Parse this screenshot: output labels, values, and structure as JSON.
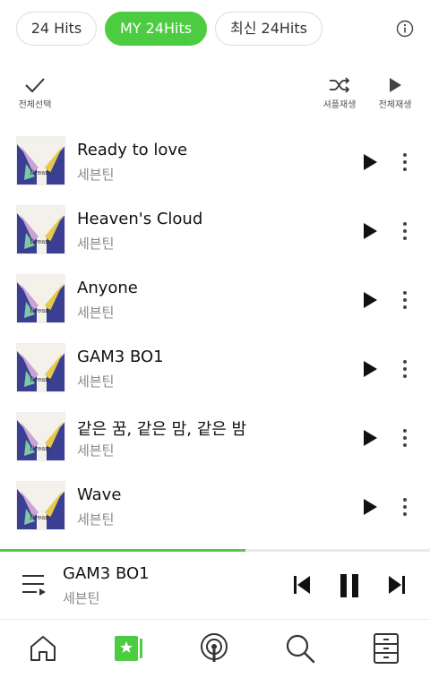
{
  "tabs": [
    {
      "label": "24 Hits",
      "active": false
    },
    {
      "label": "MY 24Hits",
      "active": true
    },
    {
      "label": "최신 24Hits",
      "active": false
    }
  ],
  "toolbar": {
    "select_all_label": "전체선택",
    "shuffle_label": "셔플재생",
    "play_all_label": "전체재생"
  },
  "tracks": [
    {
      "title": "Ready to love",
      "artist": "세븐틴"
    },
    {
      "title": "Heaven's Cloud",
      "artist": "세븐틴"
    },
    {
      "title": "Anyone",
      "artist": "세븐틴"
    },
    {
      "title": "GAM3 BO1",
      "artist": "세븐틴"
    },
    {
      "title": "같은 꿈, 같은 맘, 같은 밤",
      "artist": "세븐틴"
    },
    {
      "title": "Wave",
      "artist": "세븐틴"
    }
  ],
  "now_playing": {
    "title": "GAM3 BO1",
    "artist": "세븐틴",
    "progress": 0.57
  },
  "colors": {
    "accent": "#4ccd41",
    "text": "#111111",
    "subtext": "#888888"
  },
  "icons": {
    "info": "info-icon",
    "select_all": "checkmark-icon",
    "shuffle": "shuffle-icon",
    "play_all": "play-icon",
    "queue": "playlist-icon",
    "prev": "skip-previous-icon",
    "pause": "pause-icon",
    "next": "skip-next-icon"
  },
  "bottom_nav": [
    {
      "name": "home-icon"
    },
    {
      "name": "my-music-icon"
    },
    {
      "name": "podcast-icon"
    },
    {
      "name": "search-icon"
    },
    {
      "name": "storage-icon"
    }
  ]
}
